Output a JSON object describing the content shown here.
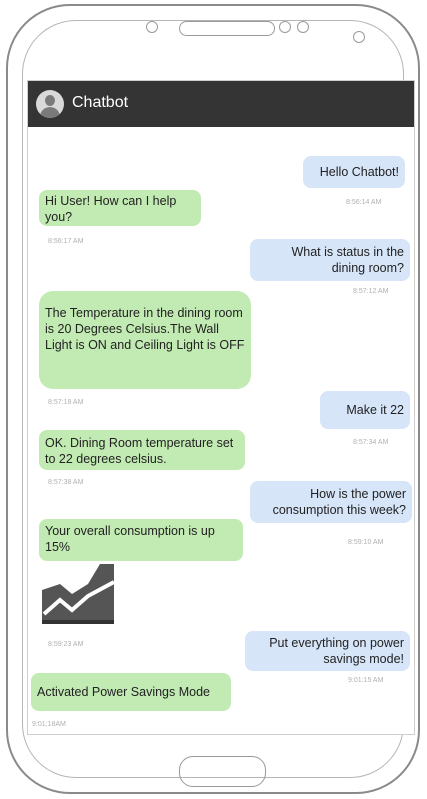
{
  "header": {
    "title": "Chatbot"
  },
  "messages": [
    {
      "sender": "user",
      "text": "Hello Chatbot!",
      "time": "8:56:14 AM"
    },
    {
      "sender": "bot",
      "text": "Hi User! How can I help you?",
      "time": "8:56:17 AM"
    },
    {
      "sender": "user",
      "text": "What is status in the dining room?",
      "time": "8:57:12 AM"
    },
    {
      "sender": "bot",
      "text": "The Temperature in the dining room is 20 Degrees Celsius.The Wall Light is ON and Ceiling Light is OFF",
      "time": "8:57:18 AM"
    },
    {
      "sender": "user",
      "text": "Make it 22",
      "time": "8:57:34 AM"
    },
    {
      "sender": "bot",
      "text": "OK. Dining Room temperature set to 22 degrees celsius.",
      "time": "8:57:38 AM"
    },
    {
      "sender": "user",
      "text": "How is the power consumption this week?",
      "time": "8:59:10 AM"
    },
    {
      "sender": "bot",
      "text": "Your overall consumption is up 15%",
      "time": "8:59:23 AM"
    },
    {
      "sender": "user",
      "text": "Put everything on power savings mode!",
      "time": "9:01:15 AM"
    },
    {
      "sender": "bot",
      "text": "Activated Power Savings Mode",
      "time": "9:01:18AM"
    }
  ],
  "attachments": {
    "chart_icon": "line-chart-image"
  },
  "colors": {
    "header_bg": "#343434",
    "user_bubble": "#d6e5f8",
    "bot_bubble": "#c2eab3"
  }
}
